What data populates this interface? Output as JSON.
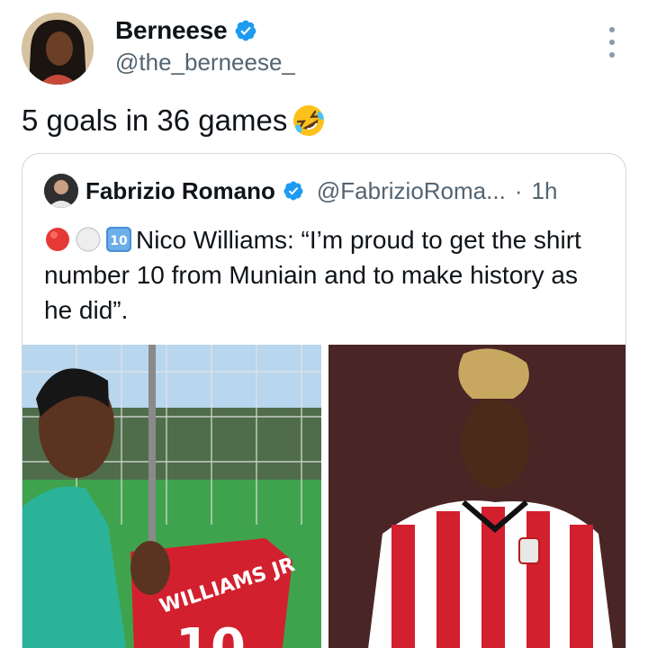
{
  "tweet": {
    "author": {
      "display_name": "Berneese",
      "handle": "@the_berneese_",
      "verified": true
    },
    "text": "5 goals in 36 games",
    "emoji": "rolling-on-the-floor-laughing",
    "more_icon": "more-options-icon"
  },
  "quote": {
    "author": {
      "display_name": "Fabrizio Romano",
      "handle": "@FabrizioRoma...",
      "verified": true
    },
    "separator": "·",
    "time": "1h",
    "badges": [
      "red-circle",
      "white-circle",
      "keycap-10"
    ],
    "text": "Nico Williams: “I’m proud to get the shirt number 10 from Muniain and to make history as he did”.",
    "media": [
      {
        "kind": "photo",
        "jersey_text": "WILLIAMS JR",
        "jersey_number": "10"
      },
      {
        "kind": "photo",
        "jersey_text": ""
      }
    ]
  },
  "colors": {
    "verified_blue": "#1d9bf0",
    "muted_text": "#536471",
    "border": "#cfd9de"
  }
}
